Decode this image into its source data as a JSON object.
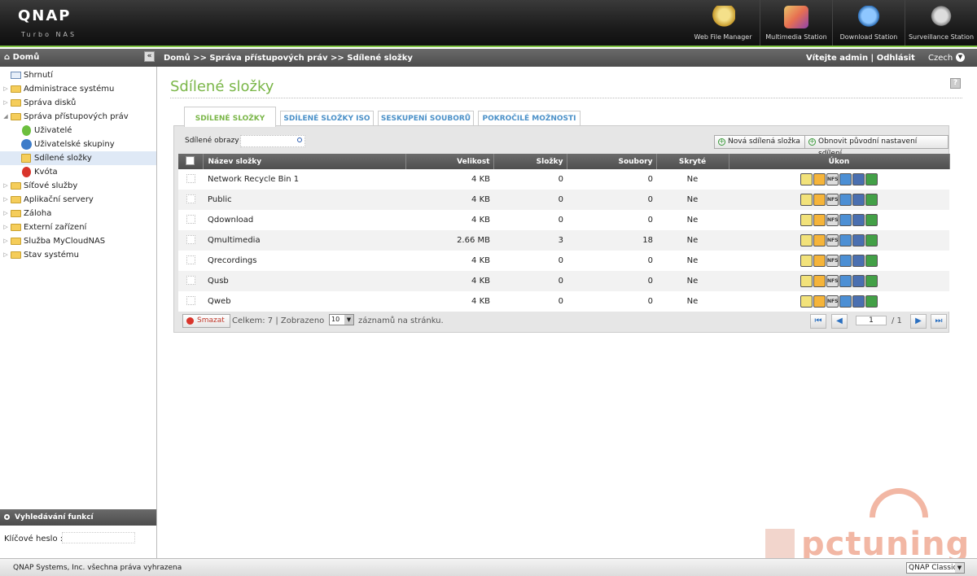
{
  "header": {
    "logo": "QNAP",
    "logo_sub": "Turbo NAS",
    "apps": [
      {
        "label": "Web File Manager",
        "icon": "web-file-manager-icon"
      },
      {
        "label": "Multimedia Station",
        "icon": "multimedia-station-icon"
      },
      {
        "label": "Download Station",
        "icon": "download-station-icon"
      },
      {
        "label": "Surveillance Station",
        "icon": "surveillance-station-icon"
      }
    ],
    "accent": "#7ec242"
  },
  "crumbbar": {
    "home": "Domů",
    "collapse": "«",
    "breadcrumb": "Domů >> Správa přístupových práv >> Sdílené složky",
    "welcome": "Vítejte admin | Odhlásit",
    "language": "Czech"
  },
  "sidebar": {
    "items": [
      {
        "label": "Shrnutí"
      },
      {
        "label": "Administrace systému"
      },
      {
        "label": "Správa disků"
      },
      {
        "label": "Správa přístupových práv"
      },
      {
        "label": "Uživatelé"
      },
      {
        "label": "Uživatelské skupiny"
      },
      {
        "label": "Sdílené složky"
      },
      {
        "label": "Kvóta"
      },
      {
        "label": "Síťové služby"
      },
      {
        "label": "Aplikační servery"
      },
      {
        "label": "Záloha"
      },
      {
        "label": "Externí zařízení"
      },
      {
        "label": "Služba MyCloudNAS"
      },
      {
        "label": "Stav systému"
      }
    ],
    "search": {
      "title": "Vyhledávání funkcí",
      "keyword_label": "Klíčové heslo :",
      "keyword_value": ""
    }
  },
  "main": {
    "title": "Sdílené složky",
    "help": "?",
    "tabs": [
      {
        "label": "SDÍLENÉ SLOŽKY"
      },
      {
        "label": "SDÍLENÉ SLOŽKY ISO"
      },
      {
        "label": "SESKUPENÍ SOUBORŮ"
      },
      {
        "label": "POKROČILÉ MOŽNOSTI"
      }
    ],
    "toolbar": {
      "share_label": "Sdílené obrazy",
      "share_value": "",
      "new_button": "Nová sdílená složka",
      "reset_button": "Obnovit původní nastavení sdílení"
    },
    "table": {
      "columns": [
        "Název složky",
        "Velikost",
        "Složky",
        "Soubory",
        "Skryté",
        "Úkon"
      ],
      "rows": [
        {
          "name": "Network Recycle Bin 1",
          "size": "4 KB",
          "folders": "0",
          "files": "0",
          "hidden": "Ne"
        },
        {
          "name": "Public",
          "size": "4 KB",
          "folders": "0",
          "files": "0",
          "hidden": "Ne"
        },
        {
          "name": "Qdownload",
          "size": "4 KB",
          "folders": "0",
          "files": "0",
          "hidden": "Ne"
        },
        {
          "name": "Qmultimedia",
          "size": "2.66 MB",
          "folders": "3",
          "files": "18",
          "hidden": "Ne"
        },
        {
          "name": "Qrecordings",
          "size": "4 KB",
          "folders": "0",
          "files": "0",
          "hidden": "Ne"
        },
        {
          "name": "Qusb",
          "size": "4 KB",
          "folders": "0",
          "files": "0",
          "hidden": "Ne"
        },
        {
          "name": "Qweb",
          "size": "4 KB",
          "folders": "0",
          "files": "0",
          "hidden": "Ne"
        }
      ],
      "action_nfs_label": "NFS"
    },
    "bottom": {
      "delete_button": "Smazat",
      "total": "Celkem: 7  |  Zobrazeno",
      "per_page_value": "10",
      "per_page_suffix": "záznamů na stránku.",
      "page_value": "1",
      "page_total": "/ 1"
    }
  },
  "footer": {
    "copyright": "QNAP Systems, Inc. všechna práva vyhrazena",
    "theme": "QNAP Classic"
  },
  "watermark": {
    "text": "pctuning"
  }
}
